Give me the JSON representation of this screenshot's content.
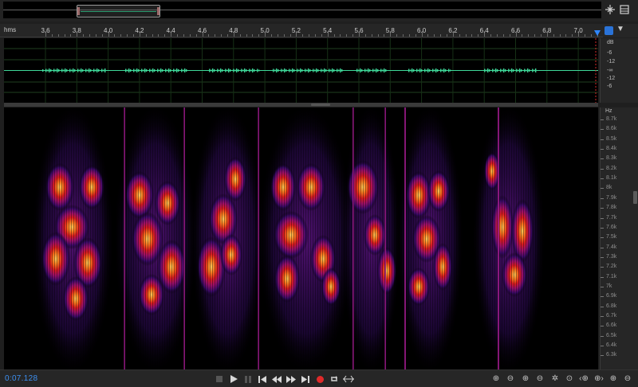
{
  "ruler": {
    "unit_label": "hms",
    "ticks": [
      "3.6",
      "3.8",
      "4.0",
      "4.2",
      "4.4",
      "4.6",
      "4.8",
      "5.0",
      "5.2",
      "5.4",
      "5.6",
      "5.8",
      "6.0",
      "6.2",
      "6.4",
      "6.6",
      "6.8",
      "7.0"
    ]
  },
  "db_scale": {
    "unit": "dB",
    "labels": [
      "-6",
      "-12",
      "-∞",
      "-12",
      "-6"
    ]
  },
  "hz_scale": {
    "unit": "Hz",
    "labels": [
      "8.7k",
      "8.6k",
      "8.5k",
      "8.4k",
      "8.3k",
      "8.2k",
      "8.1k",
      "8k",
      "7.9k",
      "7.8k",
      "7.7k",
      "7.6k",
      "7.5k",
      "7.4k",
      "7.3k",
      "7.2k",
      "7.1k",
      "7k",
      "6.9k",
      "6.8k",
      "6.7k",
      "6.6k",
      "6.5k",
      "6.4k",
      "6.3k"
    ]
  },
  "status": {
    "current_time": "0:07.128"
  },
  "icons": {
    "overview": [
      "zoom-fit-icon",
      "panel-menu-icon"
    ],
    "transport": [
      "stop-icon",
      "play-icon",
      "pause-icon",
      "go-to-start-icon",
      "rewind-icon",
      "fast-forward-icon",
      "go-to-end-icon",
      "record-icon",
      "loop-icon",
      "skip-silence-icon"
    ],
    "zoom": [
      "zoom-in-amplitude-icon",
      "zoom-out-amplitude-icon",
      "zoom-in-time-icon",
      "zoom-out-time-icon",
      "zoom-out-full-icon",
      "zoom-selection-icon",
      "zoom-in-left-icon",
      "zoom-in-right-icon",
      "zoom-in-spectral-icon",
      "zoom-out-spectral-icon"
    ]
  },
  "colors": {
    "accent": "#2f86ff",
    "waveform": "#3fd99a",
    "record": "#e02a2a",
    "playhead": "#d42a2a"
  }
}
